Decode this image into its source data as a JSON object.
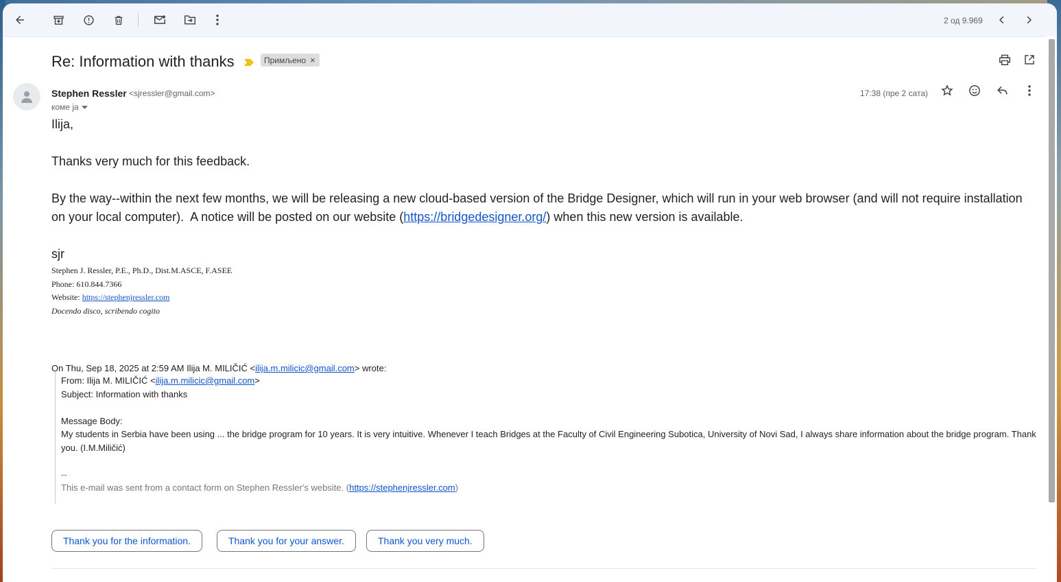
{
  "toolbar": {
    "count": "2 од 9.969"
  },
  "message": {
    "subject": "Re: Information with thanks",
    "label": "Примљено",
    "label_remove": "×",
    "sender_name": "Stephen Ressler",
    "sender_email": "<sjressler@gmail.com>",
    "to_line": "коме ја",
    "time": "17:38 (пре 2 сата)"
  },
  "body": {
    "greeting": "Ilija,",
    "para1": "Thanks very much for this feedback.",
    "para2_line1": "By the way--within the next few months, we will be releasing a new cloud-based version of the Bridge Designer, which will run in your web browser (and will not require installation",
    "para2_line2_pre": "on your local computer).  A notice will be posted on our website (",
    "para2_link": "https://bridgedesigner.org/",
    "para2_line2_post": ") when this new version is available.",
    "sign": "sjr",
    "sig_name": "Stephen J. Ressler, P.E., Ph.D., Dist.M.ASCE, F.ASEE",
    "sig_phone": "Phone: 610.844.7366",
    "sig_website_label": "Website: ",
    "sig_website_link": "https://stephenjressler.com",
    "sig_motto": "Docendo disco, scribendo cogito"
  },
  "quote": {
    "header_pre": "On Thu, Sep 18, 2025 at 2:59 AM Ilija M. MILIČIĆ <",
    "header_link": "ilija.m.milicic@gmail.com",
    "header_post": "> wrote:",
    "from_pre": "From: Ilija M. MILIČIĆ <",
    "from_link": "ilija.m.milicic@gmail.com",
    "from_post": ">",
    "subject": "Subject: Information with thanks",
    "body_label": "Message Body:",
    "body_line1": "My students in Serbia have been using ... the bridge program for 10 years. It is very intuitive. Whenever I teach Bridges at the Faculty of Civil Engineering Subotica, University of Novi Sad, I always share information about the bridge program. Thank",
    "body_line2": "you. (I.M.Miličić)",
    "dashes": "--",
    "footer_pre": "This e-mail was sent from a contact form on Stephen Ressler's website. (",
    "footer_link": "https://stephenjressler.com",
    "footer_post": ")"
  },
  "smart_replies": [
    "Thank you for the information.",
    "Thank you for your answer.",
    "Thank you very much."
  ],
  "icons": {
    "back": "arrow-left-icon",
    "archive": "archive-icon",
    "spam": "report-spam-icon",
    "delete": "trash-icon",
    "mark_unread": "mark-unread-icon",
    "move": "move-to-icon",
    "more": "more-vert-icon",
    "prev": "chevron-left-icon",
    "next": "chevron-right-icon"
  },
  "colors": {
    "link": "#1155cc",
    "smart_reply_text": "#0b57d0",
    "toolbar_bg": "#f2f6fc",
    "importance": "#f2c012"
  }
}
